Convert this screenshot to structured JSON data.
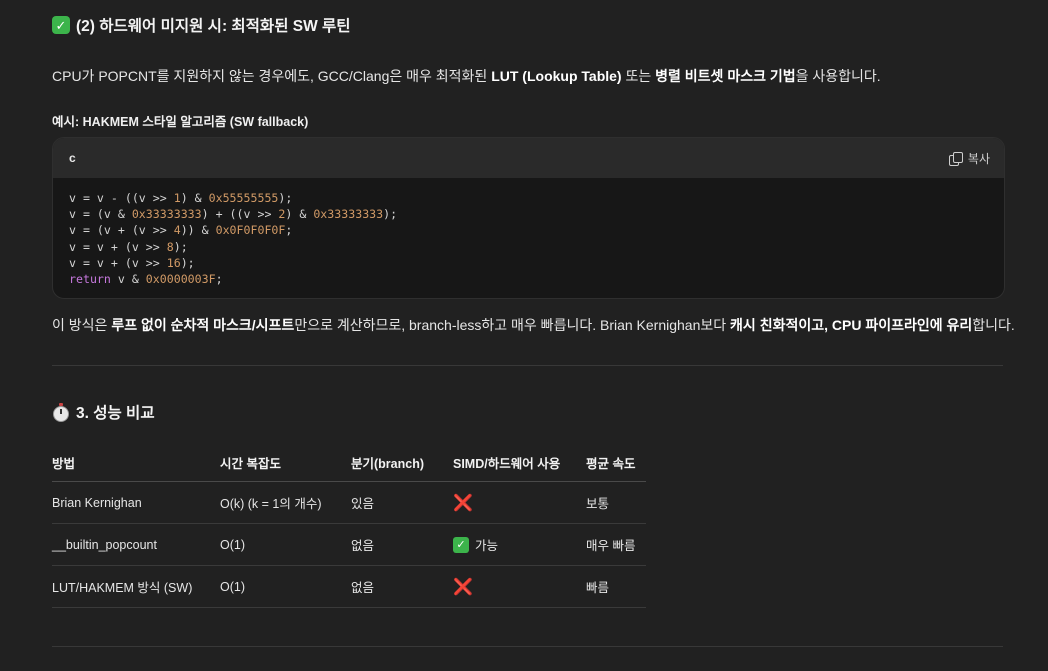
{
  "section2": {
    "check_icon": "check-mark-button-emoji",
    "heading": "(2) 하드웨어 미지원 시: 최적화된 SW 루틴"
  },
  "intro": {
    "p1": "CPU가 POPCNT를 지원하지 않는 경우에도, GCC/Clang은 매우 최적화된 ",
    "b1": "LUT (Lookup Table)",
    "p2": " 또는 ",
    "b2": "병렬 비트셋 마스크 기법",
    "p3": "을 사용합니다."
  },
  "example_label": "예시: HAKMEM 스타일 알고리즘 (SW fallback)",
  "code": {
    "language": "c",
    "copy_label": "복사",
    "lines": [
      "v = v - ((v >> 1) & 0x55555555);",
      "v = (v & 0x33333333) + ((v >> 2) & 0x33333333);",
      "v = (v + (v >> 4)) & 0x0F0F0F0F;",
      "v = v + (v >> 8);",
      "v = v + (v >> 16);",
      "return v & 0x0000003F;"
    ]
  },
  "summary": {
    "p1": "이 방식은 ",
    "b1": "루프 없이 순차적 마스크/시프트",
    "p2": "만으로 계산하므로, branch-less하고 매우 빠릅니다. Brian Kernighan보다 ",
    "b2": "캐시 친화적이고, CPU 파이프라인에 유리",
    "p3": "합니다."
  },
  "section3": {
    "icon": "stopwatch-emoji",
    "heading": "3. 성능 비교"
  },
  "table": {
    "headers": [
      "방법",
      "시간 복잡도",
      "분기(branch)",
      "SIMD/하드웨어 사용",
      "평균 속도"
    ],
    "rows": [
      [
        "Brian Kernighan",
        "O(k) (k = 1의 개수)",
        "있음",
        "❌",
        "보통"
      ],
      [
        "__builtin_popcount",
        "O(1)",
        "없음",
        "✅ 가능",
        "매우 빠름"
      ],
      [
        "LUT/HAKMEM 방식 (SW)",
        "O(1)",
        "없음",
        "❌",
        "빠름"
      ]
    ],
    "row2_simd_text": "가능",
    "cross_symbol": "❌"
  }
}
